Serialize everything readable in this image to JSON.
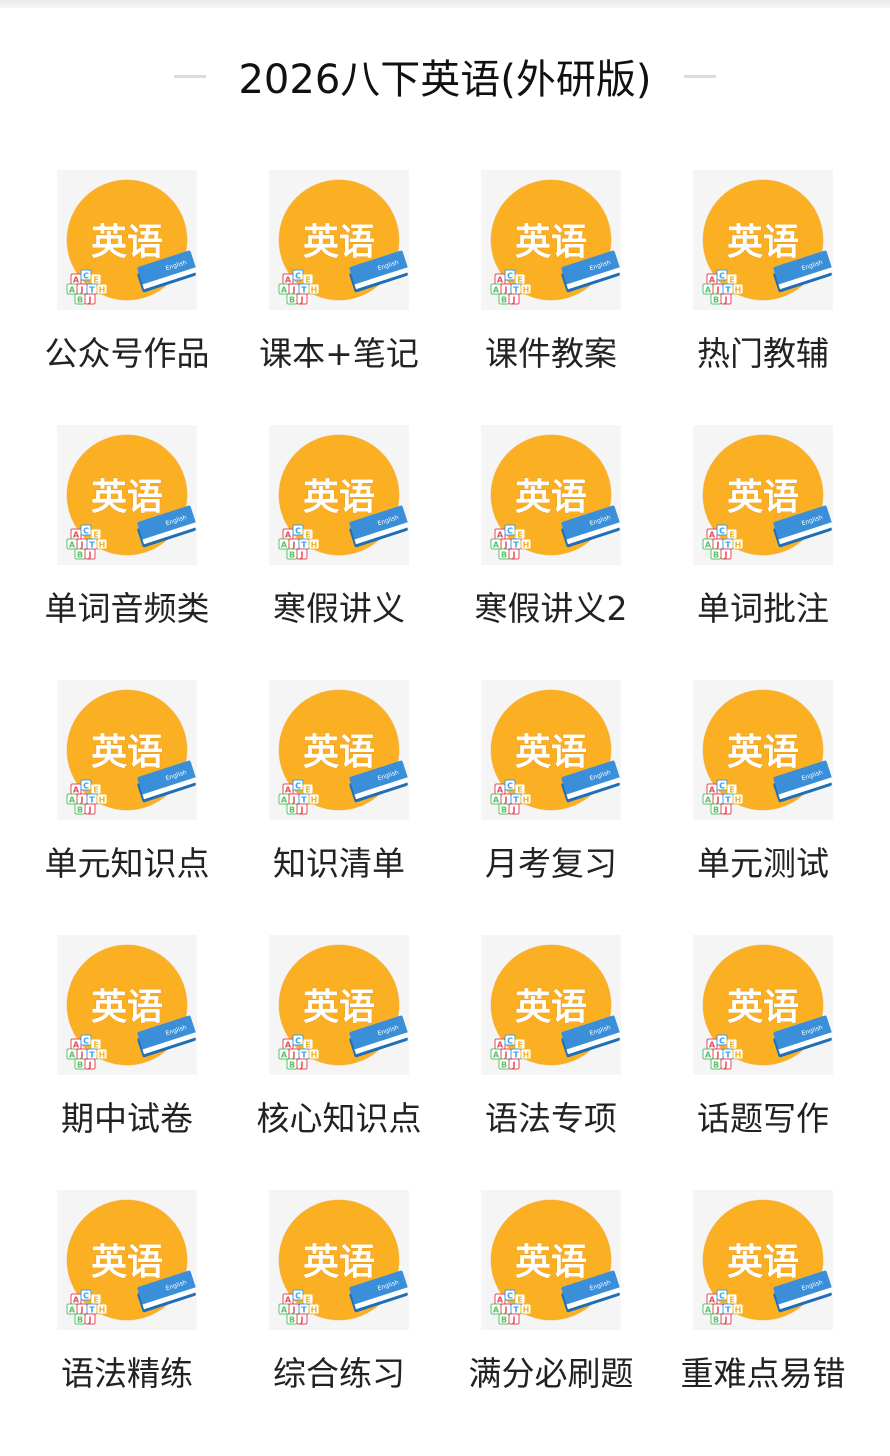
{
  "header": {
    "title": "2026八下英语(外研版)"
  },
  "icon": {
    "name": "english-book-icon",
    "badge_text": "英语",
    "book_text": "English",
    "blocks": [
      "A",
      "C",
      "E",
      "A",
      "J",
      "T",
      "H",
      "B",
      "J"
    ],
    "colors": {
      "circle": "#fbb023",
      "circle_dark": "#f39a16",
      "badge_text": "#ffffff",
      "book_blue": "#3a8fd8",
      "book_blue_dark": "#1f6fb8",
      "page_white": "#ffffff",
      "background": "#f5f5f5"
    }
  },
  "items": [
    {
      "label": "公众号作品"
    },
    {
      "label": "课本+笔记"
    },
    {
      "label": "课件教案"
    },
    {
      "label": "热门教辅"
    },
    {
      "label": "单词音频类"
    },
    {
      "label": "寒假讲义"
    },
    {
      "label": "寒假讲义2"
    },
    {
      "label": "单词批注"
    },
    {
      "label": "单元知识点"
    },
    {
      "label": "知识清单"
    },
    {
      "label": "月考复习"
    },
    {
      "label": "单元测试"
    },
    {
      "label": "期中试卷"
    },
    {
      "label": "核心知识点"
    },
    {
      "label": "语法专项"
    },
    {
      "label": "话题写作"
    },
    {
      "label": "语法精练"
    },
    {
      "label": "综合练习"
    },
    {
      "label": "满分必刷题"
    },
    {
      "label": "重难点易错"
    }
  ]
}
